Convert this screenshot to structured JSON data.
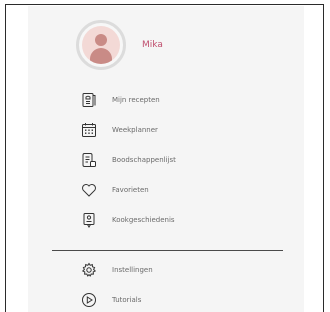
{
  "profile": {
    "name": "Mika"
  },
  "menu": {
    "items": [
      {
        "label": "Mijn recepten",
        "icon": "recipe-book-icon"
      },
      {
        "label": "Weekplanner",
        "icon": "calendar-icon"
      },
      {
        "label": "Boodschappenlijst",
        "icon": "shopping-list-icon"
      },
      {
        "label": "Favorieten",
        "icon": "heart-icon"
      },
      {
        "label": "Kookgeschiedenis",
        "icon": "history-icon"
      }
    ],
    "settings": [
      {
        "label": "Instellingen",
        "icon": "gear-icon"
      },
      {
        "label": "Tutorials",
        "icon": "play-icon"
      }
    ]
  },
  "colors": {
    "accent": "#c0506f",
    "panel": "#f5f5f5",
    "icon": "#333333"
  }
}
